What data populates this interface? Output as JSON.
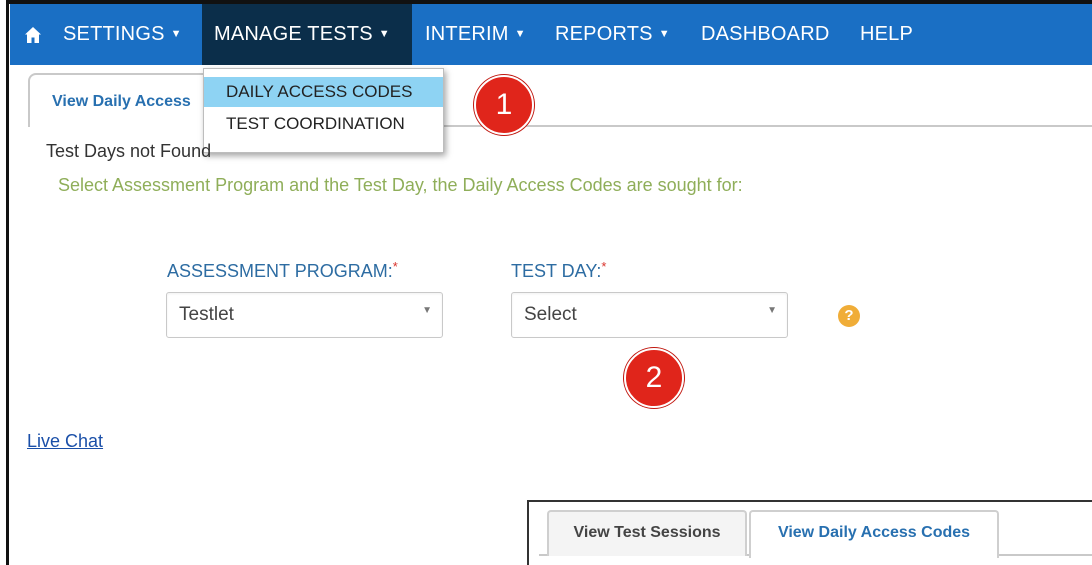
{
  "nav": {
    "home_icon": "home-icon",
    "items": [
      {
        "label": "SETTINGS",
        "has_caret": true
      },
      {
        "label": "MANAGE TESTS",
        "has_caret": true,
        "active": true
      },
      {
        "label": "INTERIM",
        "has_caret": true
      },
      {
        "label": "REPORTS",
        "has_caret": true
      },
      {
        "label": "DASHBOARD",
        "has_caret": false
      },
      {
        "label": "HELP",
        "has_caret": false
      }
    ],
    "caret": "▼"
  },
  "tabs": {
    "active_label": "View Daily Access"
  },
  "dropdown": {
    "items": [
      {
        "label": "DAILY ACCESS CODES",
        "highlighted": true
      },
      {
        "label": "TEST COORDINATION",
        "highlighted": false
      }
    ]
  },
  "annotations": {
    "badge1": "1",
    "badge2": "2"
  },
  "main": {
    "not_found": "Test Days not Found",
    "instruction": "Select Assessment Program and the Test Day, the Daily Access Codes are sought for:",
    "assessment_label": "ASSESSMENT PROGRAM:",
    "assessment_value": "Testlet",
    "testday_label": "TEST DAY:",
    "testday_value": "Select",
    "required_mark": "*",
    "select_arrow": "▼",
    "help_glyph": "?"
  },
  "footer": {
    "live_chat": "Live Chat"
  },
  "inset": {
    "tab1": "View Test Sessions",
    "tab2": "View Daily Access Codes"
  },
  "colors": {
    "navbar": "#1a6fc4",
    "nav_active": "#0b2e4a",
    "dropdown_highlight": "#8ed3f3",
    "badge": "#e0251b",
    "instruction_text": "#8fae59",
    "label_text": "#2d6ca2"
  }
}
